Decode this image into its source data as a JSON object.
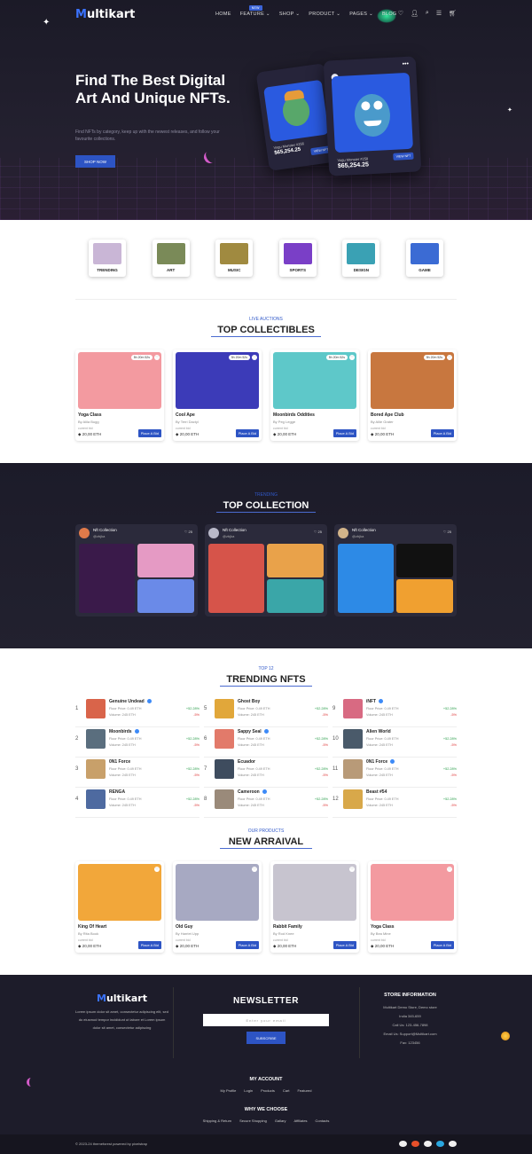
{
  "header": {
    "logo_m": "M",
    "logo_rest": "ultikart",
    "nav": [
      "HOME",
      "FEATURE",
      "SHOP",
      "PRODUCT",
      "PAGES",
      "BLOG"
    ],
    "new_badge": "NEW"
  },
  "hero": {
    "title": "Find The Best Digital Art And Unique NFTs.",
    "subtitle": "Find NFTs by category, keep up with the newest releases, and follow your favourite collections.",
    "shop_button": "SHOP NOW",
    "card1_name": "Vogu Monster #256",
    "card1_price": "$65,254.25",
    "card1_btn": "VIEW NFT",
    "card2_name": "Vogu Monster #258",
    "card2_price": "$65,254.25",
    "card2_btn": "VIEW NFT"
  },
  "categories": [
    {
      "label": "TRENDING",
      "color": "#c9b6d6"
    },
    {
      "label": "ART",
      "color": "#7a8a58"
    },
    {
      "label": "MUSIC",
      "color": "#a08a40"
    },
    {
      "label": "SPORTS",
      "color": "#7a3fc7"
    },
    {
      "label": "DESIGN",
      "color": "#3aa1b4"
    },
    {
      "label": "GAME",
      "color": "#3b6bd4"
    }
  ],
  "collectibles": {
    "eyebrow": "LIVE AUCTIONS",
    "title": "TOP COLLECTIBLES",
    "current_bid_label": "current bid",
    "bid_button": "Place A Bid",
    "items": [
      {
        "title": "Yoga Class",
        "by": "By Alila Bugg",
        "price": "20,00 ETH",
        "timer": "5h 20m 52s",
        "color": "#f39aa0"
      },
      {
        "title": "Cool Ape",
        "by": "By Terri Dactyl",
        "price": "20,00 ETH",
        "timer": "5h 20m 52s",
        "color": "#3c3bb8"
      },
      {
        "title": "Moonbirds Oddities",
        "by": "By Peg Legge",
        "price": "20,00 ETH",
        "timer": "5h 20m 52s",
        "color": "#5ec8c9"
      },
      {
        "title": "Bored Ape Club",
        "by": "By Allie Grater",
        "price": "20,00 ETH",
        "timer": "5h 20m 52s",
        "color": "#c8773f"
      }
    ]
  },
  "top_collection": {
    "eyebrow": "TRENDING",
    "title": "TOP COLLECTION",
    "items": [
      {
        "name": "Nft Collection",
        "handle": "@zbjka",
        "likes": "25"
      },
      {
        "name": "Nft Collection",
        "handle": "@zbjka",
        "likes": "25"
      },
      {
        "name": "Nft Collection",
        "handle": "@zbjka",
        "likes": "25"
      }
    ]
  },
  "trending": {
    "eyebrow": "TOP 12",
    "title": "TRENDING NFTS",
    "floor": "Floor Price: 0.49 ETH",
    "volume": "Volume: 245 ETH",
    "up": "+52.28%",
    "down": "-5%",
    "items": [
      {
        "num": "1",
        "name": "Genuine Undead",
        "color": "#d9644a"
      },
      {
        "num": "2",
        "name": "Moonbirds",
        "color": "#5a6e7e"
      },
      {
        "num": "3",
        "name": "0N1 Force",
        "color": "#c8a06a"
      },
      {
        "num": "4",
        "name": "RENGA",
        "color": "#4e6aa0"
      },
      {
        "num": "5",
        "name": "Ghost Boy",
        "color": "#e1a73a"
      },
      {
        "num": "6",
        "name": "Sappy Seal",
        "color": "#e27a6a"
      },
      {
        "num": "7",
        "name": "Ecuador",
        "color": "#3e4c5e"
      },
      {
        "num": "8",
        "name": "Cameroon",
        "color": "#9a8a7a"
      },
      {
        "num": "9",
        "name": "iNFT",
        "color": "#d86a82"
      },
      {
        "num": "10",
        "name": "Alien World",
        "color": "#4a5a6a"
      },
      {
        "num": "11",
        "name": "0N1 Force",
        "color": "#b89a78"
      },
      {
        "num": "12",
        "name": "Beast #54",
        "color": "#d8a84a"
      }
    ]
  },
  "arrival": {
    "eyebrow": "OUR PRODUCTS",
    "title": "NEW ARRAIVAL",
    "items": [
      {
        "title": "King Of Heart",
        "by": "By Rita Book",
        "price": "20,00 ETH",
        "color": "#f2a73a"
      },
      {
        "title": "Old Guy",
        "by": "By Harriet Upp",
        "price": "20,00 ETH",
        "color": "#a7a9c2"
      },
      {
        "title": "Rabbit Family",
        "by": "By Rod Knee",
        "price": "20,00 ETH",
        "color": "#c7c4cf"
      },
      {
        "title": "Yoga Class",
        "by": "By Bea Mine",
        "price": "20,00 ETH",
        "color": "#f39aa0"
      }
    ]
  },
  "footer": {
    "about": "Lorem ipsum dolor sit amet, consectetur adipiscing elit, sed do eiusmod tempor incididunt ut labore et Lorem ipsum dolor sit amet, consectetur adipiscing",
    "newsletter_title": "NEWSLETTER",
    "email_placeholder": "Enter your email",
    "subscribe": "SUBSCRIBE",
    "store_title": "STORE INFORMATION",
    "store_lines": [
      "Multikart Demo Store, Demo store",
      "India 345-659",
      "Call Us: 123-456-7898",
      "Email Us: Support@Multikart.com",
      "Fax: 123456"
    ],
    "my_account": "MY ACCOUNT",
    "account_links": [
      "My Profile",
      "Login",
      "Products",
      "Cart",
      "Featured"
    ],
    "why_title": "WHY WE CHOOSE",
    "why_links": [
      "Shipping & Return",
      "Secure Shopping",
      "Gallary",
      "Affiliates",
      "Contacts"
    ],
    "copyright": "© 2023-24 themeforest powered by pixelstrap"
  }
}
